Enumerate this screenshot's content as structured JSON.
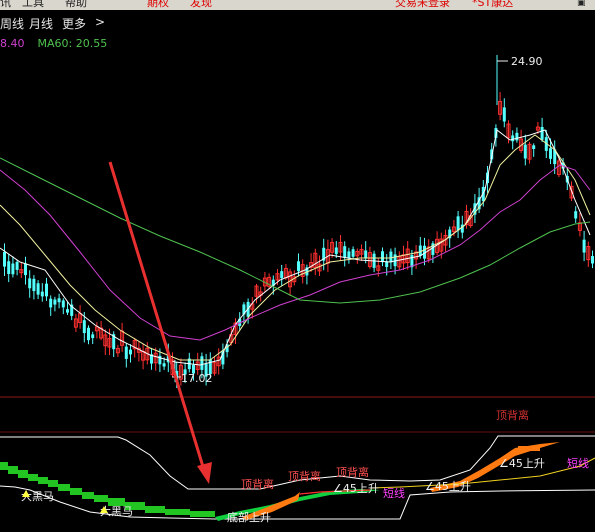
{
  "top_menu": {
    "items": [
      "讯",
      "工具",
      "帮助"
    ],
    "highlight_items": [
      "期权",
      "发现"
    ],
    "ticker": "交易未登录",
    "ticker2": "*ST康达"
  },
  "period_tabs": {
    "items": [
      "周线",
      "月线",
      "更多",
      ">"
    ]
  },
  "ma_legend": {
    "ma_left": "8.40",
    "ma60_label": "MA60: 20.55",
    "ma60_color": "#4fc14f",
    "ma_left_color": "#d040d0"
  },
  "price_labels": {
    "high": "24.90",
    "low": "17.02"
  },
  "indicator": {
    "top_label": "顶背离",
    "labels": {
      "dingbeili_1": "顶背离",
      "dingbeili_2": "顶背离",
      "dingbeili_3": "顶背离",
      "up45_1": "∠45上升",
      "up45_2": "∠45上升",
      "up45_3": "∠45上升",
      "duanxian_1": "短线",
      "duanxian_2": "短线",
      "dahema_1": "大黑马",
      "dahema_2": "大黑马",
      "bottom_mixed": "底部上升"
    }
  },
  "colors": {
    "up_candle": "#ff3030",
    "down_candle": "#54ffff",
    "ma5": "#ffffff",
    "ma10": "#f0f0a0",
    "ma20": "#d040d0",
    "ma60": "#4fc14f",
    "arrow": "#e83030",
    "band_green": "#22c522",
    "band_orange": "#ff7a10",
    "magenta_text": "#ff40ff",
    "label_red": "#ff4040"
  }
}
